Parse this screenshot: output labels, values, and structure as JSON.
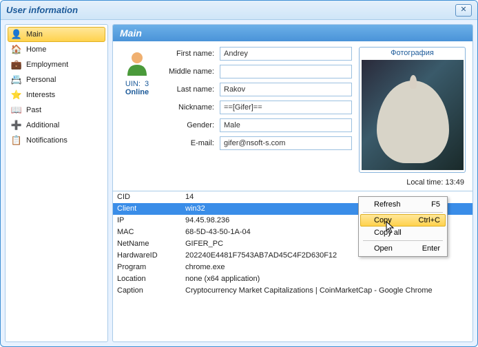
{
  "window": {
    "title": "User information"
  },
  "sidebar": {
    "items": [
      {
        "label": "Main",
        "icon": "👤"
      },
      {
        "label": "Home",
        "icon": "🏠"
      },
      {
        "label": "Employment",
        "icon": "💼"
      },
      {
        "label": "Personal",
        "icon": "📇"
      },
      {
        "label": "Interests",
        "icon": "⭐"
      },
      {
        "label": "Past",
        "icon": "📖"
      },
      {
        "label": "Additional",
        "icon": "➕"
      },
      {
        "label": "Notifications",
        "icon": "📋"
      }
    ]
  },
  "main": {
    "header": "Main",
    "uin_label": "UIN:",
    "uin_value": "3",
    "status": "Online",
    "fields": {
      "first_name": {
        "label": "First name:",
        "value": "Andrey"
      },
      "middle_name": {
        "label": "Middle name:",
        "value": ""
      },
      "last_name": {
        "label": "Last name:",
        "value": "Rakov"
      },
      "nickname": {
        "label": "Nickname:",
        "value": "==[Gifer]=="
      },
      "gender": {
        "label": "Gender:",
        "value": "Male"
      },
      "email": {
        "label": "E-mail:",
        "value": "gifer@nsoft-s.com"
      }
    },
    "photo_title": "Фотография",
    "local_time_label": "Local time:",
    "local_time_value": "13:49"
  },
  "grid": [
    {
      "k": "CID",
      "v": "14"
    },
    {
      "k": "Client",
      "v": "win32",
      "sel": true
    },
    {
      "k": "IP",
      "v": "94.45.98.236"
    },
    {
      "k": "MAC",
      "v": "68-5D-43-50-1A-04"
    },
    {
      "k": "NetName",
      "v": "GIFER_PC"
    },
    {
      "k": "HardwareID",
      "v": "202240E4481F7543AB7AD45C4F2D630F12"
    },
    {
      "k": "Program",
      "v": "chrome.exe"
    },
    {
      "k": "Location",
      "v": "none (x64 application)"
    },
    {
      "k": "Caption",
      "v": "Cryptocurrency Market Capitalizations | CoinMarketCap - Google Chrome"
    }
  ],
  "context_menu": {
    "refresh": {
      "label": "Refresh",
      "shortcut": "F5"
    },
    "copy": {
      "label": "Copy",
      "shortcut": "Ctrl+C"
    },
    "copy_all": {
      "label": "Copy all",
      "shortcut": ""
    },
    "open": {
      "label": "Open",
      "shortcut": "Enter"
    }
  }
}
